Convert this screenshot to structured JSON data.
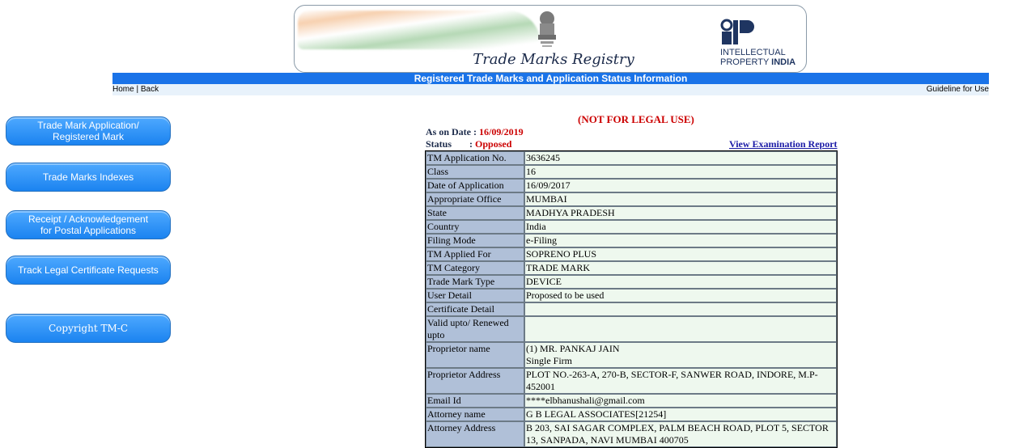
{
  "header": {
    "registry_title": "Trade Marks Registry",
    "ip_line1": "INTELLECTUAL",
    "ip_line2_prefix": "PROPERTY ",
    "ip_line2_bold": "INDIA"
  },
  "title_bar": "Registered Trade Marks and Application Status Information",
  "nav": {
    "home": "Home",
    "separator": " | ",
    "back": "Back",
    "guideline": "Guideline for Use"
  },
  "sidebar": [
    "Trade Mark Application/\nRegistered Mark",
    "Trade Marks Indexes",
    "Receipt / Acknowledgement\nfor Postal Applications",
    "Track Legal Certificate Requests",
    "Copyright TM-C"
  ],
  "notice": "(NOT FOR LEGAL USE)",
  "as_on_date_label": "As on Date : ",
  "as_on_date_value": "16/09/2019",
  "status_label": "Status",
  "status_colon": ": ",
  "status_value": "Opposed",
  "view_report_link": "View Examination Report",
  "details": [
    {
      "label": "TM Application No.",
      "value": "3636245"
    },
    {
      "label": "Class",
      "value": "16"
    },
    {
      "label": "Date of Application",
      "value": "16/09/2017"
    },
    {
      "label": "Appropriate Office",
      "value": "MUMBAI"
    },
    {
      "label": "State",
      "value": "MADHYA PRADESH"
    },
    {
      "label": "Country",
      "value": "India"
    },
    {
      "label": "Filing Mode",
      "value": "e-Filing"
    },
    {
      "label": "TM Applied For",
      "value": "SOPRENO PLUS"
    },
    {
      "label": "TM Category",
      "value": "TRADE MARK"
    },
    {
      "label": "Trade Mark Type",
      "value": "DEVICE"
    },
    {
      "label": "User Detail",
      "value": "Proposed to be used"
    },
    {
      "label": "Certificate Detail",
      "value": ""
    },
    {
      "label": "Valid upto/ Renewed upto",
      "value": ""
    },
    {
      "label": "Proprietor name",
      "value": "(1) MR. PANKAJ JAIN\nSingle Firm"
    },
    {
      "label": "Proprietor Address",
      "value": "PLOT NO.-263-A, 270-B, SECTOR-F, SANWER ROAD, INDORE, M.P-452001"
    },
    {
      "label": "Email Id",
      "value": "****elbhanushali@gmail.com"
    },
    {
      "label": "Attorney name",
      "value": "G B LEGAL ASSOCIATES[21254]"
    },
    {
      "label": "Attorney Address",
      "value": "B 203, SAI SAGAR COMPLEX, PALM BEACH ROAD, PLOT 5, SECTOR 13, SANPADA, NAVI MUMBAI 400705"
    }
  ]
}
